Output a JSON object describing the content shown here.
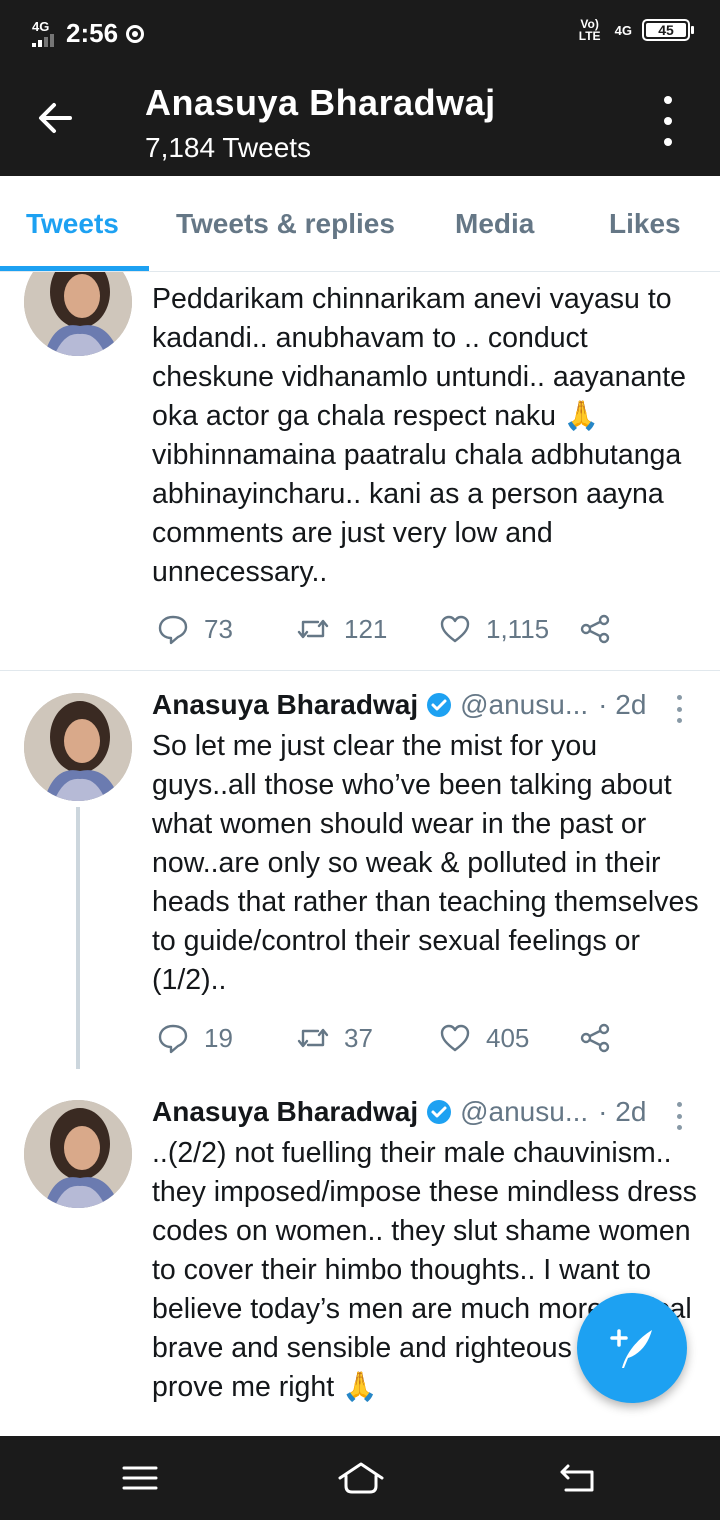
{
  "status_bar": {
    "network": "4G",
    "time": "2:56",
    "volte": "Vo) LTE",
    "net_right": "4G",
    "battery": "45"
  },
  "app_bar": {
    "title": "Anasuya Bharadwaj",
    "subtitle": "7,184 Tweets"
  },
  "tabs": [
    {
      "label": "Tweets",
      "active": true
    },
    {
      "label": "Tweets & replies",
      "active": false
    },
    {
      "label": "Media",
      "active": false
    },
    {
      "label": "Likes",
      "active": false
    }
  ],
  "tweets": [
    {
      "text": "Peddarikam chinnarikam anevi vayasu to kadandi.. anubhavam to .. conduct cheskune vidhanamlo untundi.. aayanante oka actor ga chala respect naku 🙏 vibhinnamaina paatralu chala adbhutanga abhinayincharu.. kani as a person aayna comments are just very low and unnecessary..",
      "replies": "73",
      "retweets": "121",
      "likes": "1,115"
    },
    {
      "name": "Anasuya Bharadwaj",
      "handle": "@anusu...",
      "time": "· 2d",
      "text": "So let me just clear the mist for you guys..all those who’ve been talking about what women should wear in the past or now..are only so weak & polluted in their heads that rather than teaching themselves to guide/control their sexual feelings or (1/2)..",
      "replies": "19",
      "retweets": "37",
      "likes": "405"
    },
    {
      "name": "Anasuya Bharadwaj",
      "handle": "@anusu...",
      "time": "· 2d",
      "text": "..(2/2) not fuelling their male chauvinism.. they imposed/impose these mindless dress codes on women.. they slut shame women to cover their himbo thoughts.. I want to believe today’s men are much more logical brave and sensible and righteous please prove me right 🙏"
    }
  ],
  "colors": {
    "accent": "#1da1f2",
    "dark_bar": "#1b1b1b",
    "muted": "#657786"
  },
  "icons": {
    "back": "arrow-left-icon",
    "more": "more-vertical-icon",
    "reply": "reply-icon",
    "retweet": "retweet-icon",
    "like": "heart-icon",
    "share": "share-icon",
    "compose": "compose-tweet-icon"
  }
}
